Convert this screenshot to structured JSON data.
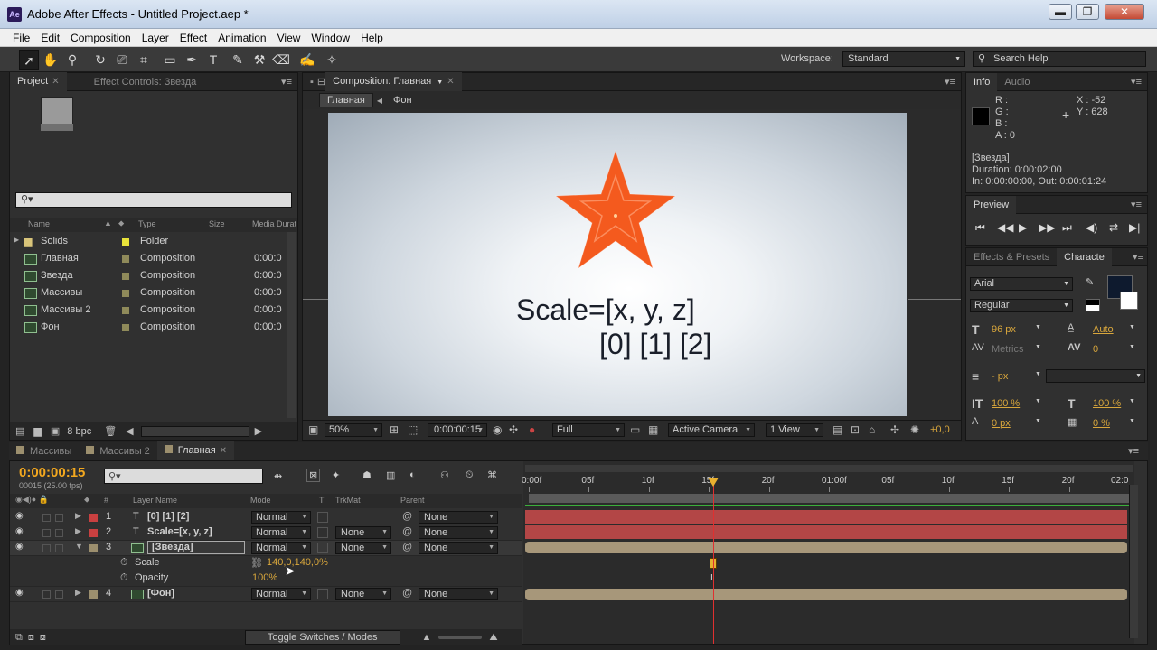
{
  "window": {
    "title": "Adobe After Effects - Untitled Project.aep *",
    "logo": "Ae",
    "minimize": "▬",
    "maximize": "❐",
    "close": "✕"
  },
  "menu": [
    "File",
    "Edit",
    "Composition",
    "Layer",
    "Effect",
    "Animation",
    "View",
    "Window",
    "Help"
  ],
  "toolbar": {
    "workspace_label": "Workspace:",
    "workspace_value": "Standard",
    "help_search": "Search Help"
  },
  "project": {
    "tab": "Project",
    "tab2": "Effect Controls: Звезда",
    "search_placeholder": "⚲▾",
    "columns": {
      "name": "Name",
      "type": "Type",
      "size": "Size",
      "duration": "Media Durat"
    },
    "items": [
      {
        "name": "Solids",
        "type": "Folder",
        "dur": "",
        "color": "#e8e23a"
      },
      {
        "name": "Главная",
        "type": "Composition",
        "dur": "0:00:0",
        "color": "#8f8a5a"
      },
      {
        "name": "Звезда",
        "type": "Composition",
        "dur": "0:00:0",
        "color": "#8f8a5a"
      },
      {
        "name": "Массивы",
        "type": "Composition",
        "dur": "0:00:0",
        "color": "#8f8a5a"
      },
      {
        "name": "Массивы 2",
        "type": "Composition",
        "dur": "0:00:0",
        "color": "#8f8a5a"
      },
      {
        "name": "Фон",
        "type": "Composition",
        "dur": "0:00:0",
        "color": "#8f8a5a"
      }
    ],
    "bpc": "8 bpc"
  },
  "comp": {
    "tab": "Composition: Главная",
    "crumbs": [
      "Главная",
      "Фон"
    ],
    "text_line1": "Scale=[x, y, z]",
    "text_line2": "[0] [1] [2]",
    "zoom": "50%",
    "time": "0:00:00:15",
    "resolution": "Full",
    "camera": "Active Camera",
    "views": "1 View",
    "exposure": "+0,0",
    "star_color": "#f45a1e"
  },
  "info": {
    "tab": "Info",
    "tab2": "Audio",
    "r": "R :",
    "g": "G :",
    "b": "B :",
    "a": "A : 0",
    "x": "X : -52",
    "y": "Y : 628",
    "layer": "[Звезда]",
    "duration": "Duration: 0:00:02:00",
    "inout": "In: 0:00:00:00, Out: 0:00:01:24"
  },
  "preview": {
    "tab": "Preview"
  },
  "character": {
    "tab1": "Effects & Presets",
    "tab2": "Characte",
    "font": "Arial",
    "style": "Regular",
    "size": "96 px",
    "leading": "Auto",
    "kerning": "Metrics",
    "tracking": "0",
    "stroke": "- px",
    "vscale": "100 %",
    "hscale": "100 %",
    "baseline": "0 px",
    "tsume": "0 %"
  },
  "timeline": {
    "tabs": [
      "Массивы",
      "Массивы 2",
      "Главная"
    ],
    "timecode": "0:00:00:15",
    "fps": "00015 (25.00 fps)",
    "columns": {
      "num": "#",
      "name": "Layer Name",
      "mode": "Mode",
      "t": "T",
      "trkmat": "TrkMat",
      "parent": "Parent"
    },
    "ruler": [
      "0:00f",
      "05f",
      "10f",
      "15f",
      "20f",
      "01:00f",
      "05f",
      "10f",
      "15f",
      "20f",
      "02:0"
    ],
    "layers": [
      {
        "num": "1",
        "name": "[0] [1] [2]",
        "mode": "Normal",
        "trk": "",
        "parent": "None",
        "color": "#c94040",
        "type": "text"
      },
      {
        "num": "2",
        "name": "Scale=[x, y, z]",
        "mode": "Normal",
        "trk": "None",
        "parent": "None",
        "color": "#c94040",
        "type": "text"
      },
      {
        "num": "3",
        "name": "[Звезда]",
        "mode": "Normal",
        "trk": "None",
        "parent": "None",
        "color": "#9c8f6e",
        "type": "comp"
      },
      {
        "num": "4",
        "name": "[Фон]",
        "mode": "Normal",
        "trk": "None",
        "parent": "None",
        "color": "#9c8f6e",
        "type": "comp"
      }
    ],
    "props": [
      {
        "name": "Scale",
        "value": "140,0,140,0%"
      },
      {
        "name": "Opacity",
        "value": "100%"
      }
    ],
    "toggle": "Toggle Switches / Modes"
  }
}
